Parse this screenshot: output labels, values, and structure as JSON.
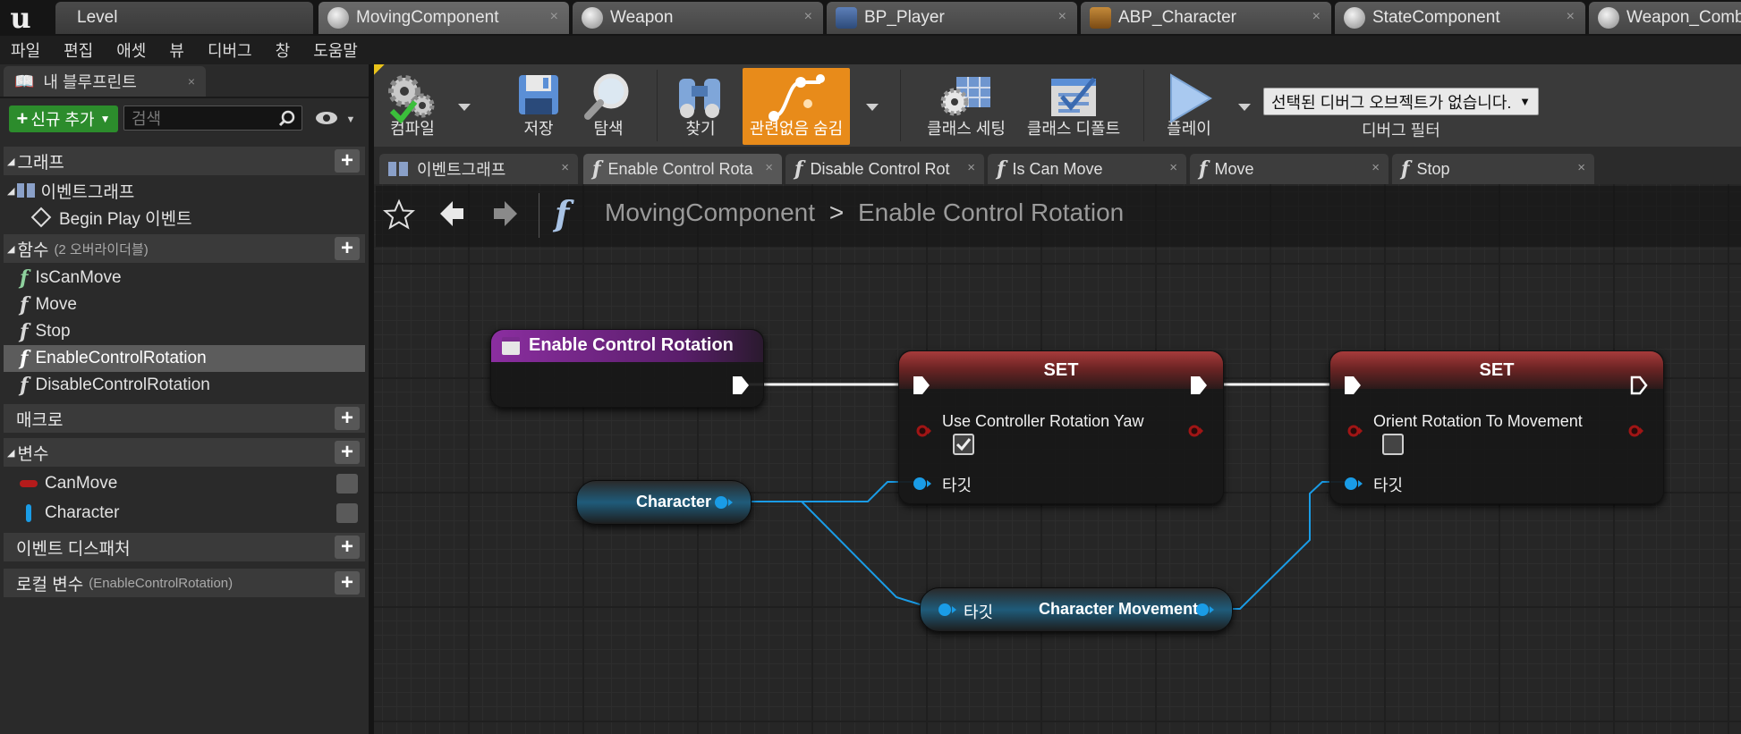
{
  "doc_tabs": [
    {
      "label": "Level"
    },
    {
      "label": "MovingComponent"
    },
    {
      "label": "Weapon"
    },
    {
      "label": "BP_Player"
    },
    {
      "label": "ABP_Character"
    },
    {
      "label": "StateComponent"
    },
    {
      "label": "Weapon_Combo"
    }
  ],
  "close_glyph": "×",
  "menu": [
    "파일",
    "편집",
    "애셋",
    "뷰",
    "디버그",
    "창",
    "도움말"
  ],
  "my_blueprint": {
    "tab_label": "내 블루프린트",
    "add_button": "신규 추가",
    "search_placeholder": "검색",
    "sections": {
      "graphs": "그래프",
      "functions": "함수",
      "functions_note": "(2 오버라이더블)",
      "macros": "매크로",
      "variables": "변수",
      "dispatchers": "이벤트 디스패처",
      "locals": "로컬 변수",
      "locals_note": "(EnableControlRotation)"
    },
    "event_graph": "이벤트그래프",
    "begin_play": "Begin Play 이벤트",
    "functions": [
      "IsCanMove",
      "Move",
      "Stop",
      "EnableControlRotation",
      "DisableControlRotation"
    ],
    "selected_function": "EnableControlRotation",
    "variables": [
      {
        "name": "CanMove",
        "type_color": "#b51b1b"
      },
      {
        "name": "Character",
        "type_color": "#1a9ce6"
      }
    ]
  },
  "toolbar": {
    "compile": "컴파일",
    "save": "저장",
    "browse": "탐색",
    "find": "찾기",
    "hide_unrelated": "관련없음 숨김",
    "class_settings": "클래스 세팅",
    "class_defaults": "클래스 디폴트",
    "play": "플레이",
    "debug_object": "선택된 디버그 오브젝트가 없습니다.",
    "debug_filter": "디버그 필터"
  },
  "graph_tabs": [
    {
      "label": "이벤트그래프"
    },
    {
      "label": "Enable Control Rota"
    },
    {
      "label": "Disable Control Rot"
    },
    {
      "label": "Is Can Move"
    },
    {
      "label": "Move"
    },
    {
      "label": "Stop"
    }
  ],
  "breadcrumb": {
    "root": "MovingComponent",
    "separator": ">",
    "current": "Enable Control Rotation"
  },
  "nodes": {
    "entry": {
      "title": "Enable Control Rotation"
    },
    "set1": {
      "title": "SET",
      "var_label": "Use Controller Rotation Yaw",
      "value_checked": true,
      "target_label": "타깃"
    },
    "set2": {
      "title": "SET",
      "var_label": "Orient Rotation To Movement",
      "value_checked": false,
      "target_label": "타깃"
    },
    "character_getter": {
      "label": "Character"
    },
    "movement_getter": {
      "target_label": "타깃",
      "label": "Character Movement"
    }
  },
  "colors": {
    "exec_wire": "#ffffff",
    "object_pin": "#1a9ce6",
    "bool_pin": "#8f1212",
    "function_header": "#7b2b8f",
    "hide_unrelated_active": "#e88b1a"
  }
}
